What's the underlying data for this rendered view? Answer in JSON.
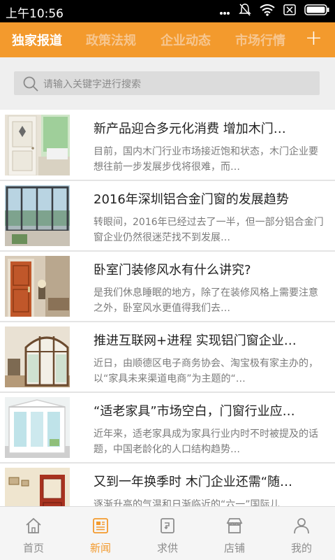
{
  "status_bar": {
    "time": "上午10:56"
  },
  "tabs": [
    {
      "label": "独家报道",
      "active": true
    },
    {
      "label": "政策法规",
      "active": false
    },
    {
      "label": "企业动态",
      "active": false
    },
    {
      "label": "市场行情",
      "active": false
    }
  ],
  "add_tab_label": "+",
  "search": {
    "placeholder": "请输入关键字进行搜索"
  },
  "articles": [
    {
      "title": "新产品迎合多元化消费 增加木门…",
      "desc": "目前，国内木门行业市场接近饱和状态，木门企业要想往前一步发展步伐将很难，而…"
    },
    {
      "title": "2016年深圳铝合金门窗的发展趋势",
      "desc": "转眼间，2016年已经过去了一半，但一部分铝合金门窗企业仍然很迷茫找不到发展…"
    },
    {
      "title": "卧室门装修风水有什么讲究?",
      "desc": "是我们休息睡眠的地方，除了在装修风格上需要注意之外，卧室风水更值得我们去…"
    },
    {
      "title": "推进互联网+进程 实现铝门窗企业…",
      "desc": "近日，由顺德区电子商务协会、淘宝极有家主办的，以“家具未来渠道电商”为主题的“…"
    },
    {
      "title": "“适老家具”市场空白，门窗行业应…",
      "desc": "近年来，适老家具成为家具行业内时不时被提及的话题，中国老龄化的人口结构趋势…"
    },
    {
      "title": "又到一年换季时 木门企业还需“随…",
      "desc": "逐渐升高的气温和日渐临近的“六一”国际儿…"
    }
  ],
  "bottom_nav": [
    {
      "label": "首页",
      "icon": "home-icon",
      "active": false
    },
    {
      "label": "新闻",
      "icon": "news-icon",
      "active": true
    },
    {
      "label": "求供",
      "icon": "supply-icon",
      "active": false
    },
    {
      "label": "店铺",
      "icon": "store-icon",
      "active": false
    },
    {
      "label": "我的",
      "icon": "profile-icon",
      "active": false
    }
  ],
  "colors": {
    "accent": "#f39a2d",
    "tab_inactive": "#f6c690",
    "status_bar": "#000000"
  }
}
